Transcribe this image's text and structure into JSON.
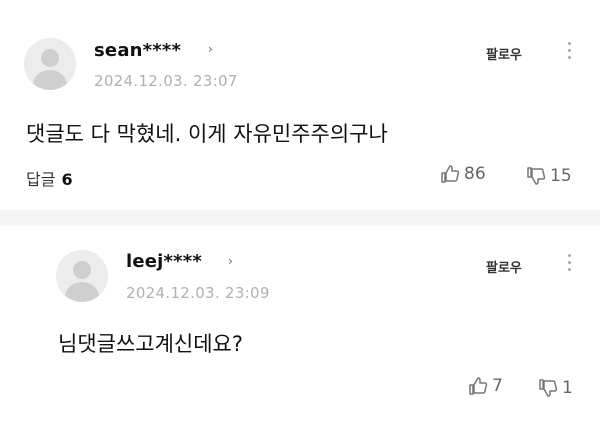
{
  "comments": [
    {
      "username": "sean****",
      "timestamp": "2024.12.03. 23:07",
      "follow_label": "팔로우",
      "text": "댓글도 다 막혔네. 이게 자유민주주의구나",
      "replies_label": "답글",
      "replies_count": "6",
      "likes": "86",
      "dislikes": "15"
    },
    {
      "username": "leej****",
      "timestamp": "2024.12.03. 23:09",
      "follow_label": "팔로우",
      "text": "님댓글쓰고계신데요?",
      "likes": "7",
      "dislikes": "1"
    }
  ],
  "icons": [
    "avatar",
    "chevron-right-icon",
    "more-vertical-icon",
    "thumbs-up-icon",
    "thumbs-down-icon"
  ]
}
